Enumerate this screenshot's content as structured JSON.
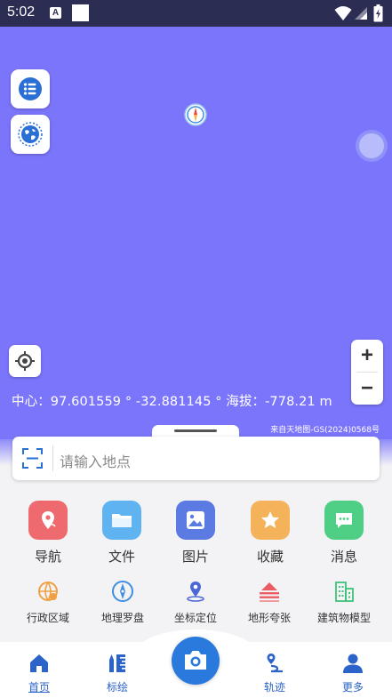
{
  "status_bar": {
    "time": "5:02",
    "notification_icon_letter": "A",
    "icons": [
      "a-icon",
      "square-icon",
      "wifi-icon",
      "signal-icon",
      "battery-icon"
    ]
  },
  "map": {
    "background_color": "#7b75fb",
    "center_readout": "中心：97.601559 ° -32.881145 ° 海拔：-778.21 m",
    "attribution": "来自天地图-GS(2024)0568号",
    "zoom_in_label": "+",
    "zoom_out_label": "−",
    "buttons": [
      "layers-list-icon",
      "globe-icon",
      "locate-icon",
      "compass-icon"
    ]
  },
  "search": {
    "placeholder": "请输入地点"
  },
  "main_actions": [
    {
      "label": "导航",
      "icon": "navigation-pin-icon",
      "color": "#ee6a6e"
    },
    {
      "label": "文件",
      "icon": "folder-icon",
      "color": "#5eb3f0"
    },
    {
      "label": "图片",
      "icon": "picture-icon",
      "color": "#5b7be3"
    },
    {
      "label": "收藏",
      "icon": "star-icon",
      "color": "#f4b25a"
    },
    {
      "label": "消息",
      "icon": "message-icon",
      "color": "#4fcf86"
    }
  ],
  "tools": [
    {
      "label": "行政区域",
      "icon": "admin-region-icon",
      "color": "#f0a040"
    },
    {
      "label": "地理罗盘",
      "icon": "geo-compass-icon",
      "color": "#3f8fe0"
    },
    {
      "label": "坐标定位",
      "icon": "coordinate-pin-icon",
      "color": "#4a67d6"
    },
    {
      "label": "地形夸张",
      "icon": "terrain-exaggeration-icon",
      "color": "#ea5d62"
    },
    {
      "label": "建筑物模型",
      "icon": "building-model-icon",
      "color": "#3fc27a"
    }
  ],
  "tab_bar": {
    "accent_color": "#2b63c9",
    "tabs": [
      {
        "label": "首页",
        "icon": "home-icon",
        "active": true
      },
      {
        "label": "标绘",
        "icon": "plot-ruler-icon",
        "active": false
      },
      {
        "label": "轨迹",
        "icon": "track-icon",
        "active": false
      },
      {
        "label": "更多",
        "icon": "user-more-icon",
        "active": false
      }
    ],
    "center_button_icon": "camera-icon",
    "center_button_color": "#2a79dd"
  }
}
